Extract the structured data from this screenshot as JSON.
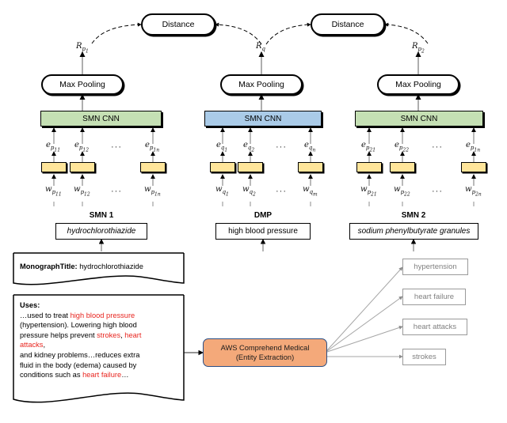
{
  "diagram": {
    "title": "Siamese network architecture with AWS Comprehend Medical entity extraction",
    "colors": {
      "cnn_green": "#c5e0b4",
      "cnn_blue": "#aacbe8",
      "embedding_yellow": "#ffe59a",
      "aws_orange": "#f4a97a",
      "aws_border": "#2a4f86",
      "entity_red": "#e8251f",
      "entity_box_gray": "#9a9a9a"
    },
    "distance_nodes": [
      {
        "label": "Distance"
      },
      {
        "label": "Distance"
      }
    ],
    "pooling_nodes": [
      {
        "label": "Max Pooling"
      },
      {
        "label": "Max Pooling"
      },
      {
        "label": "Max Pooling"
      }
    ],
    "cnn_nodes": [
      {
        "label": "SMN CNN",
        "color": "green"
      },
      {
        "label": "SMN CNN",
        "color": "blue"
      },
      {
        "label": "SMN CNN",
        "color": "green"
      }
    ],
    "representation_labels": [
      {
        "base": "R",
        "sub": "p",
        "subsub": "1"
      },
      {
        "base": "R",
        "sub": "q",
        "subsub": ""
      },
      {
        "base": "R",
        "sub": "p",
        "subsub": "2"
      }
    ],
    "branches": [
      {
        "group_title": "SMN 1",
        "term": "hydrochlorothiazide",
        "term_style": "italic",
        "embeddings": [
          {
            "base": "e",
            "sub": "p",
            "subsub": "11"
          },
          {
            "base": "e",
            "sub": "p",
            "subsub": "12"
          },
          {
            "base": "e",
            "sub": "p",
            "subsub": "1n"
          }
        ],
        "words": [
          {
            "base": "w",
            "sub": "p",
            "subsub": "11"
          },
          {
            "base": "w",
            "sub": "p",
            "subsub": "12"
          },
          {
            "base": "w",
            "sub": "p",
            "subsub": "1n"
          }
        ],
        "ellipsis": "···"
      },
      {
        "group_title": "DMP",
        "term": "high blood pressure",
        "term_style": "normal",
        "embeddings": [
          {
            "base": "e",
            "sub": "q",
            "subsub": "1"
          },
          {
            "base": "e",
            "sub": "q",
            "subsub": "2"
          },
          {
            "base": "e",
            "sub": "q",
            "subsub": "n"
          }
        ],
        "words": [
          {
            "base": "w",
            "sub": "q",
            "subsub": "1"
          },
          {
            "base": "w",
            "sub": "q",
            "subsub": "2"
          },
          {
            "base": "w",
            "sub": "q",
            "subsub": "m"
          }
        ],
        "ellipsis": "···"
      },
      {
        "group_title": "SMN 2",
        "term": "sodium phenylbutyrate granules",
        "term_style": "italic",
        "embeddings": [
          {
            "base": "e",
            "sub": "p",
            "subsub": "21"
          },
          {
            "base": "e",
            "sub": "p",
            "subsub": "22"
          },
          {
            "base": "e",
            "sub": "p",
            "subsub": "1n"
          }
        ],
        "words": [
          {
            "base": "w",
            "sub": "p",
            "subsub": "21"
          },
          {
            "base": "w",
            "sub": "p",
            "subsub": "22"
          },
          {
            "base": "w",
            "sub": "p",
            "subsub": "2n"
          }
        ],
        "ellipsis": "···"
      }
    ],
    "monograph": {
      "field_label": "MonographTitle:",
      "field_value": "hydrochlorothiazide"
    },
    "uses_document": {
      "heading": "Uses:",
      "lines": [
        [
          {
            "t": "…used to treat ",
            "red": false
          },
          {
            "t": "high blood pressure",
            "red": true
          }
        ],
        [
          {
            "t": "(hypertension). Lowering high blood",
            "red": false
          }
        ],
        [
          {
            "t": "pressure helps prevent ",
            "red": false
          },
          {
            "t": "strokes",
            "red": true
          },
          {
            "t": ", ",
            "red": false
          },
          {
            "t": "heart",
            "red": true
          }
        ],
        [
          {
            "t": "attacks",
            "red": true
          },
          {
            "t": ",",
            "red": false
          }
        ],
        [
          {
            "t": "and kidney problems…reduces extra",
            "red": false
          }
        ],
        [
          {
            "t": "fluid in the body (edema) caused by",
            "red": false
          }
        ],
        [
          {
            "t": "conditions such as ",
            "red": false
          },
          {
            "t": "heart failure",
            "red": true
          },
          {
            "t": "…",
            "red": false
          }
        ]
      ]
    },
    "aws": {
      "line1": "AWS Comprehend Medical",
      "line2": "(Entity Extraction)"
    },
    "extracted_entities": [
      {
        "label": "hypertension"
      },
      {
        "label": "heart failure"
      },
      {
        "label": "heart attacks"
      },
      {
        "label": "strokes"
      }
    ]
  }
}
